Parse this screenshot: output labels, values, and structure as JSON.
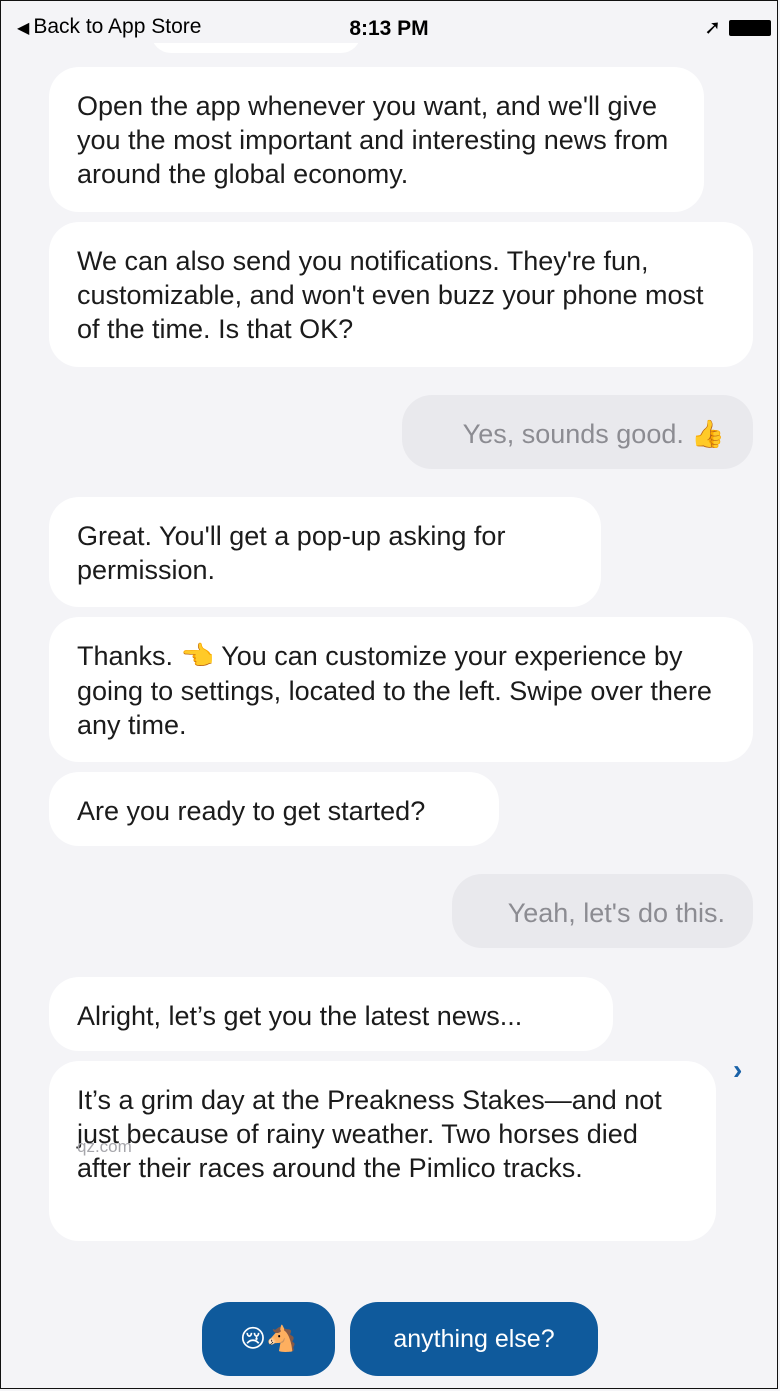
{
  "status_bar": {
    "back_label": "Back to App Store",
    "time": "8:13 PM"
  },
  "messages": [
    {
      "from": "bot",
      "text": "Open the app whenever you want, and we'll give you the most important and interesting news from around the global economy."
    },
    {
      "from": "bot",
      "text": "We can also send you notifications. They're fun, customizable, and won't even buzz your phone most of the time. Is that OK?"
    },
    {
      "from": "user",
      "text": "Yes, sounds good.",
      "emoji": "👍"
    },
    {
      "from": "bot",
      "text": "Great. You'll get a pop-up asking for permission."
    },
    {
      "from": "bot",
      "text_before": "Thanks.",
      "emoji": "👈",
      "text_after": "You can customize your experience by going to settings, located to the left. Swipe over there any time."
    },
    {
      "from": "bot",
      "text": "Are you ready to get started?"
    },
    {
      "from": "user",
      "text": "Yeah, let's do this."
    },
    {
      "from": "bot",
      "text": "Alright, let’s get you the latest news..."
    },
    {
      "from": "bot",
      "text": "It’s a grim day at the Preakness Stakes—and not just because of rainy weather. Two horses died after their races around the Pimlico tracks."
    }
  ],
  "news_source": "qz.com",
  "quick_replies": [
    {
      "emoji": "😢🐴"
    },
    {
      "label": "anything else?"
    }
  ],
  "colors": {
    "background": "#f4f4f7",
    "bot_bubble": "#ffffff",
    "user_bubble": "#e9e9ed",
    "reply_button": "#0f5a9c"
  }
}
